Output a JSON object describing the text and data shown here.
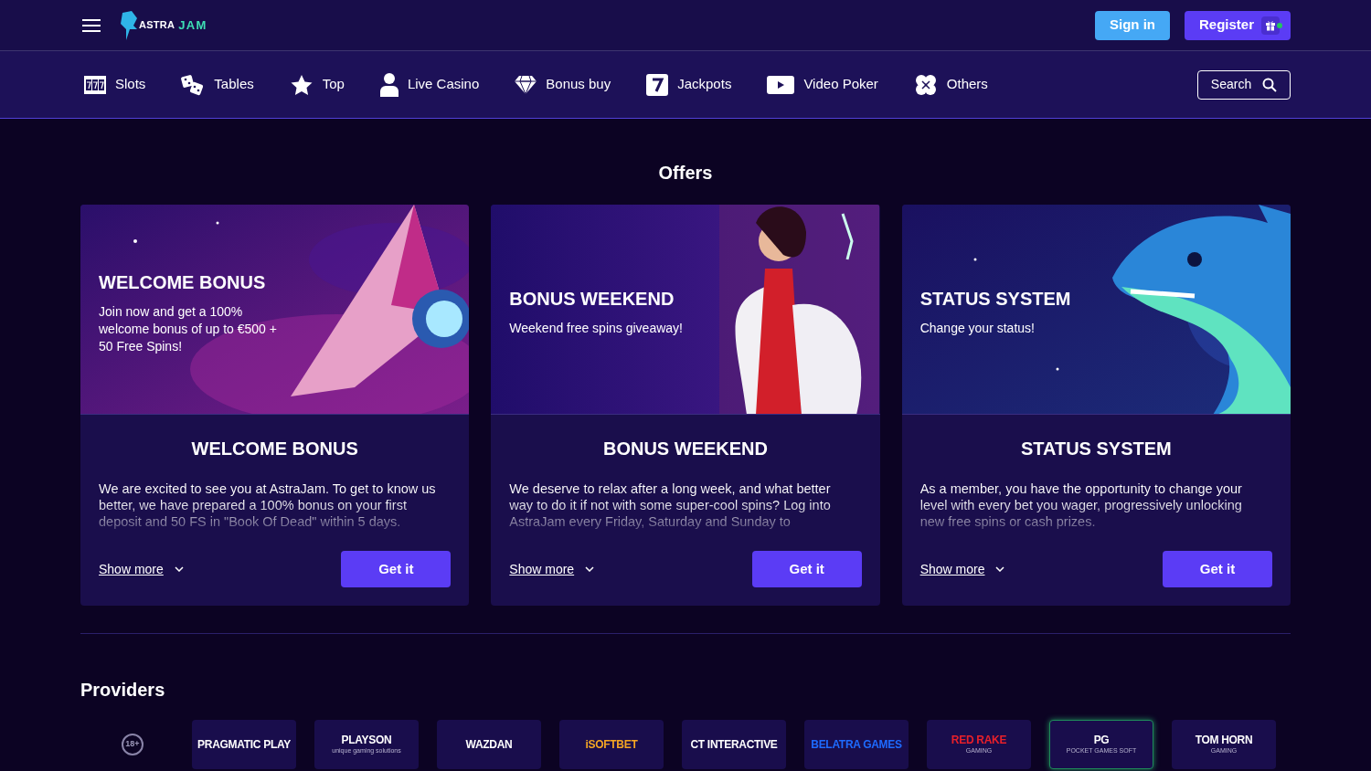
{
  "logo": {
    "first": "ASTRA",
    "second": "JAM"
  },
  "auth": {
    "sign_in": "Sign in",
    "register": "Register",
    "register_dot": true
  },
  "nav": [
    {
      "label": "Slots",
      "kind": "slots"
    },
    {
      "label": "Tables",
      "kind": "dice"
    },
    {
      "label": "Top",
      "kind": "star"
    },
    {
      "label": "Live Casino",
      "kind": "person"
    },
    {
      "label": "Bonus buy",
      "kind": "diamond"
    },
    {
      "label": "Jackpots",
      "kind": "seven"
    },
    {
      "label": "Video Poker",
      "kind": "play"
    },
    {
      "label": "Others",
      "kind": "clover"
    }
  ],
  "search": {
    "label": "Search"
  },
  "offers": {
    "title": "Offers",
    "cards": [
      {
        "banner_title": "WELCOME BONUS",
        "banner_text": "Join now and get a 100% welcome bonus of up to €500 + 50 Free Spins!",
        "title": "WELCOME BONUS",
        "description": "We are excited to see you at AstraJam. To get to know us better, we have prepared a 100% bonus on your first deposit and 50 FS in \"Book Of Dead\" within 5 days.",
        "show_more": "Show more",
        "action": "Get it"
      },
      {
        "banner_title": "BONUS WEEKEND",
        "banner_text": "Weekend free spins giveaway!",
        "title": "BONUS WEEKEND",
        "description": "We deserve to relax after a long week, and what better way to do it if not with some super-cool spins? Log into AstraJam every Friday, Saturday and Sunday to",
        "show_more": "Show more",
        "action": "Get it"
      },
      {
        "banner_title": "STATUS SYSTEM",
        "banner_text": "Change your status!",
        "title": "STATUS SYSTEM",
        "description": "As a member, you have the opportunity to change your level with every bet you wager, progressively unlocking new free spins or cash prizes.",
        "show_more": "Show more",
        "action": "Get it"
      }
    ]
  },
  "providers": {
    "title": "Providers",
    "age_badge": "18+",
    "items": [
      {
        "name": "PRAGMATIC PLAY",
        "color": "#ffffff",
        "selected": false
      },
      {
        "name": "PLAYSON",
        "tagline": "unique gaming solutions",
        "color": "#ffffff",
        "selected": false
      },
      {
        "name": "WAZDAN",
        "color": "#ffffff",
        "selected": false
      },
      {
        "name": "iSOFTBET",
        "color": "#f5a623",
        "selected": false
      },
      {
        "name": "CT INTERACTIVE",
        "color": "#ffffff",
        "selected": false
      },
      {
        "name": "BELATRA GAMES",
        "color": "#1e6bff",
        "selected": false
      },
      {
        "name": "RED RAKE",
        "tagline": "GAMING",
        "color": "#e8202a",
        "selected": false
      },
      {
        "name": "PG",
        "tagline": "POCKET GAMES SOFT",
        "color": "#ffffff",
        "selected": true
      },
      {
        "name": "TOM HORN",
        "tagline": "GAMING",
        "color": "#ffffff",
        "selected": false
      }
    ]
  }
}
